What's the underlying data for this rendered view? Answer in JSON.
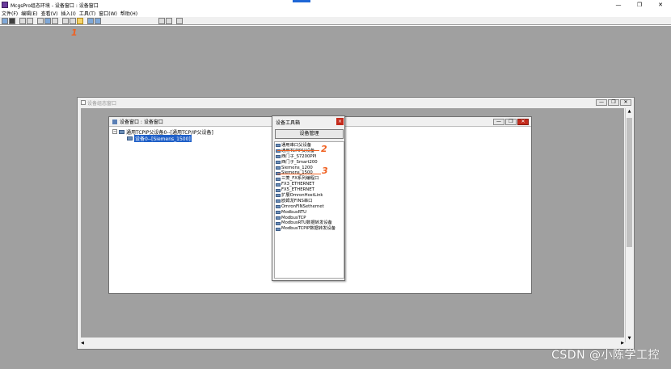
{
  "app": {
    "title": "McgsPro组态环境 - 设备窗口 : 设备窗口",
    "window_controls": [
      "—",
      "❐",
      "✕"
    ]
  },
  "menu": [
    "文件(F)",
    "编辑(E)",
    "查看(V)",
    "插入(I)",
    "工具(T)",
    "窗口(W)",
    "帮助(H)"
  ],
  "child_window": {
    "title": "设备组态窗口",
    "controls": [
      "—",
      "❐",
      "✕"
    ]
  },
  "device_window": {
    "title": "设备窗口 : 设备窗口",
    "controls": [
      "—",
      "❐",
      "✕"
    ],
    "tree": {
      "parent": "通用TCPIP父设备0--[通用TCP/IP父设备]",
      "child": "设备0--[Siemens_1500]"
    }
  },
  "toolbox": {
    "title": "设备工具箱",
    "close": "×",
    "manage_button": "设备管理",
    "items": [
      "通用串口父设备",
      "通用TCPIP父设备",
      "西门子_S7200PPI",
      "西门子_Smart200",
      "Siemens_1200",
      "Siemens_1500",
      "三菱_FX系列编程口",
      "FX3_ETHERNET",
      "FX5_ETHERNET",
      "扩展OmronHostLink",
      "欧姆龙FINS串口",
      "OmronFINSethernet",
      "ModbusRTU",
      "ModbusTCP",
      "ModbusRTU数据转发设备",
      "ModbusTCPIP数据转发设备"
    ]
  },
  "annotations": {
    "step1": "1",
    "step2": "2",
    "step3": "3"
  },
  "watermark": "CSDN @小陈学工控",
  "colors": {
    "workspace": "#a0a0a0",
    "selection": "#2060c8",
    "annotation": "#f06020",
    "close_red": "#c42b1c"
  }
}
